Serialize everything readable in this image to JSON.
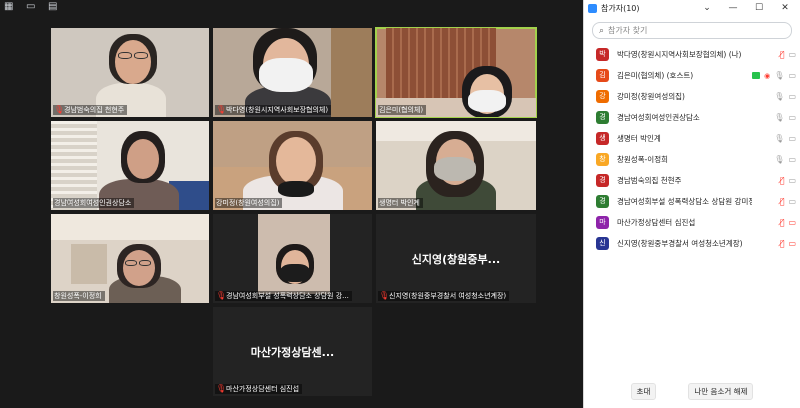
{
  "toolbar": {
    "icons": [
      "grid-icon",
      "speaker-icon",
      "gallery-icon"
    ]
  },
  "tiles": [
    {
      "name": "경남범숙의집 천현주",
      "mic_muted": true
    },
    {
      "name": "박다영(창원시지역사회보장협의체)",
      "mic_muted": true
    },
    {
      "name": "김은미(협의체)",
      "mic_muted": false
    },
    {
      "name": "경남여성회여성인권상담소",
      "mic_muted": false
    },
    {
      "name": "강미정(창원여성의집)",
      "mic_muted": false
    },
    {
      "name": "생명터 박인계",
      "mic_muted": false
    },
    {
      "name": "창원성폭-이정희",
      "mic_muted": false
    },
    {
      "name": "경남여성회부설 성폭력상담소 상담원 강...",
      "mic_muted": true
    },
    {
      "name": "신지영(창원중부경찰서 여성청소년계장)",
      "mic_muted": true,
      "big_label": "신지영(창원중부..."
    },
    {
      "name": "마산가정상담센터 심진섭",
      "mic_muted": true,
      "big_label": "마산가정상담센..."
    }
  ],
  "panel": {
    "title": "참가자(10)",
    "win_controls": [
      "⌄",
      "—",
      "☐",
      "✕"
    ],
    "search_placeholder": "참가자 찾기",
    "participants": [
      {
        "avatar": "박",
        "color": "#c62828",
        "name": "박다영(창원시지역사회보장협의체) (나)",
        "mic": "off",
        "video": "on"
      },
      {
        "avatar": "김",
        "color": "#e64a19",
        "name": "김은미(협의체) (호스트)",
        "mic": "on",
        "video": "on",
        "sharing": true
      },
      {
        "avatar": "강",
        "color": "#ef6c00",
        "name": "강미정(창원여성의집)",
        "mic": "on",
        "video": "on"
      },
      {
        "avatar": "경",
        "color": "#2e7d32",
        "name": "경남여성회여성인권상담소",
        "mic": "on",
        "video": "on"
      },
      {
        "avatar": "생",
        "color": "#c62828",
        "name": "생명터 박인계",
        "mic": "on",
        "video": "on"
      },
      {
        "avatar": "창",
        "color": "#f9a825",
        "name": "창원성폭-이정희",
        "mic": "on",
        "video": "on"
      },
      {
        "avatar": "경",
        "color": "#c62828",
        "name": "경남범숙의집 천현주",
        "mic": "off",
        "video": "on"
      },
      {
        "avatar": "경",
        "color": "#2e7d32",
        "name": "경남여성회부설 성폭력상담소 상담원 강미정",
        "mic": "off",
        "video": "on"
      },
      {
        "avatar": "마",
        "color": "#8e24aa",
        "name": "마산가정상담센터 심진섭",
        "mic": "off",
        "video": "off"
      },
      {
        "avatar": "신",
        "color": "#283593",
        "name": "신지영(창원중부경찰서 여성청소년계장)",
        "mic": "off",
        "video": "off"
      }
    ],
    "invite_label": "초대",
    "mute_me_label": "나만 음소거 해제"
  }
}
